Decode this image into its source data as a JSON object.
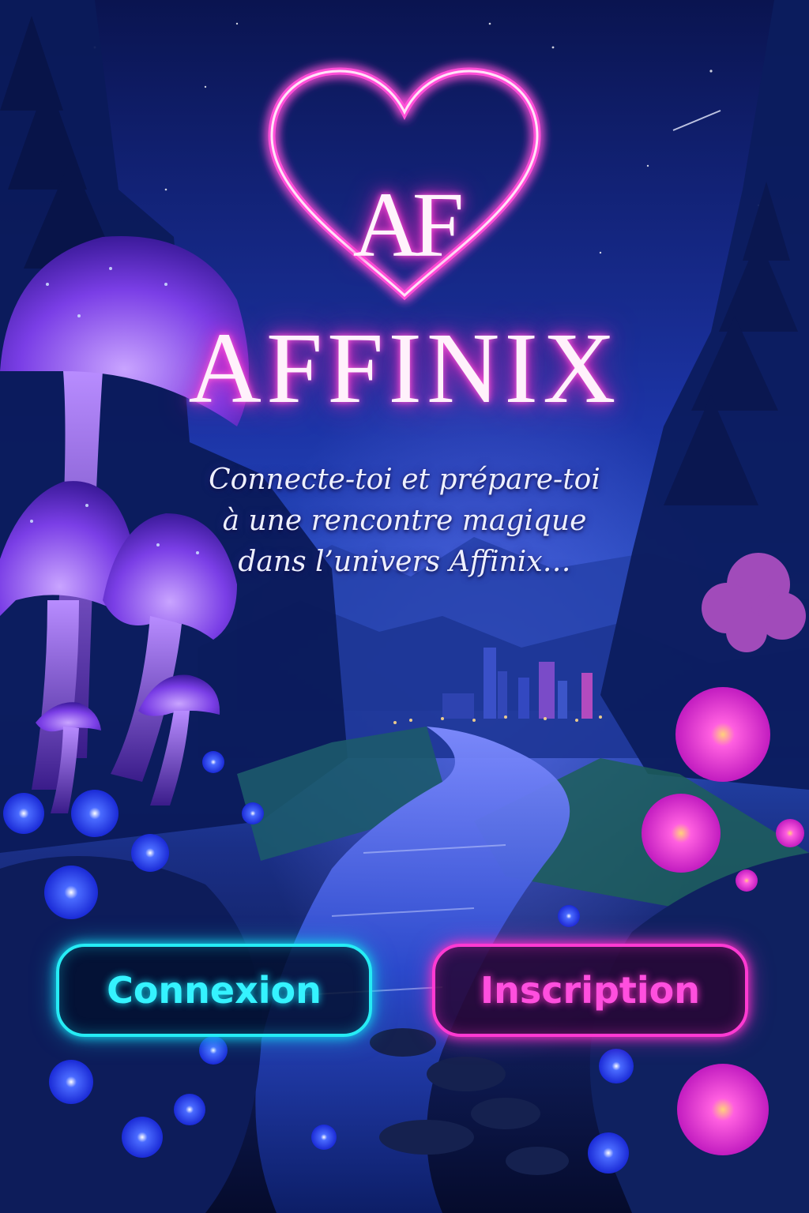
{
  "app": {
    "monogram": "AF",
    "brand_name": "AFFINIX",
    "tagline": {
      "line1": "Connecte-toi et prépare-toi",
      "line2": "à une rencontre magique",
      "line3": "dans l’univers Affinix…"
    }
  },
  "actions": {
    "login_label": "Connexion",
    "signup_label": "Inscription"
  },
  "colors": {
    "neon_pink": "#ff2fc9",
    "neon_cyan": "#26ecf5",
    "sky_dark": "#06103a",
    "sky_mid": "#1f3ab8"
  },
  "icons": [
    "heart-logo-icon"
  ]
}
